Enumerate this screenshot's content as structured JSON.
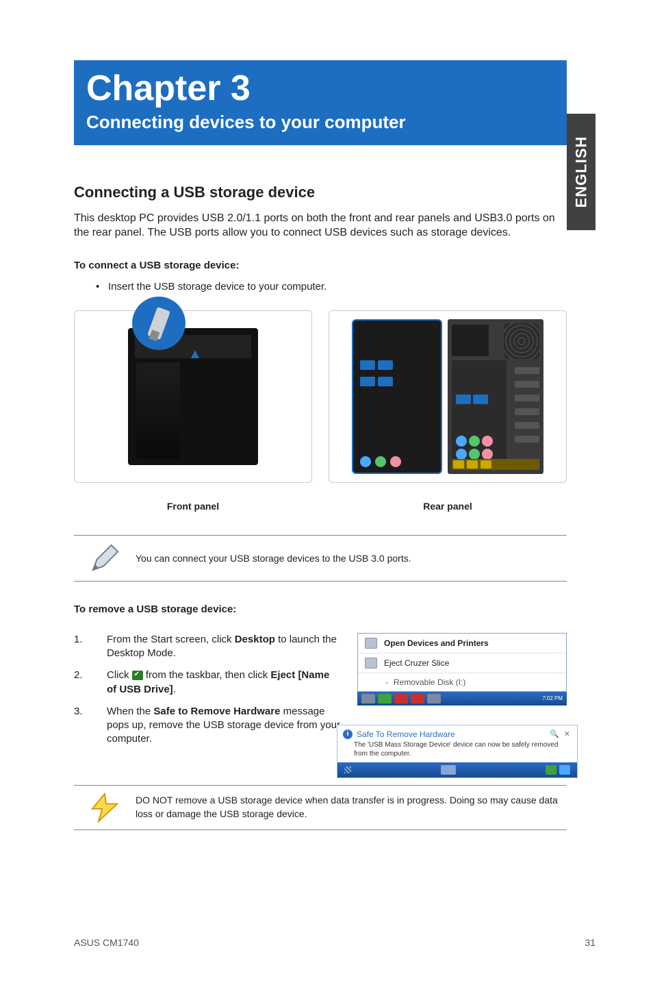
{
  "language_tab": "ENGLISH",
  "banner": {
    "chapter": "Chapter 3",
    "subtitle": "Connecting devices to your computer"
  },
  "section": {
    "title": "Connecting a USB storage device",
    "intro": "This desktop PC provides USB 2.0/1.1 ports on both the front and rear panels and USB3.0 ports on the rear panel. The USB ports allow you to connect USB devices such as storage devices.",
    "connect_head": "To connect a USB storage device:",
    "connect_bullet": "Insert the USB storage device to your computer."
  },
  "captions": {
    "front": "Front panel",
    "rear": "Rear panel"
  },
  "note_usb3": "You can connect your USB storage devices to the USB 3.0 ports.",
  "remove": {
    "head": "To remove a USB storage device:",
    "steps": [
      {
        "n": "1.",
        "pre": "From the Start screen, click ",
        "bold": "Desktop",
        "post": " to launch the Desktop Mode."
      },
      {
        "n": "2.",
        "pre": "Click ",
        "bold2": "Eject [Name of USB Drive]",
        "post": " from the taskbar, then click "
      },
      {
        "n": "3.",
        "pre": "When the ",
        "bold": "Safe to Remove Hardware",
        "post": " message pops up, remove the USB storage device from your computer."
      }
    ]
  },
  "popup1": {
    "open_devices": "Open Devices and Printers",
    "eject": "Eject Cruzer Slice",
    "removable": "Removable Disk (I:)",
    "taskbar_time": "7:02 PM"
  },
  "popup2": {
    "title": "Safe To Remove Hardware",
    "body": "The 'USB Mass Storage Device' device can now be safely removed from the computer."
  },
  "caution": "DO NOT remove a USB storage device when data transfer is in progress. Doing so may cause data loss or damage the USB storage device.",
  "footer": {
    "model": "ASUS CM1740",
    "page": "31"
  }
}
